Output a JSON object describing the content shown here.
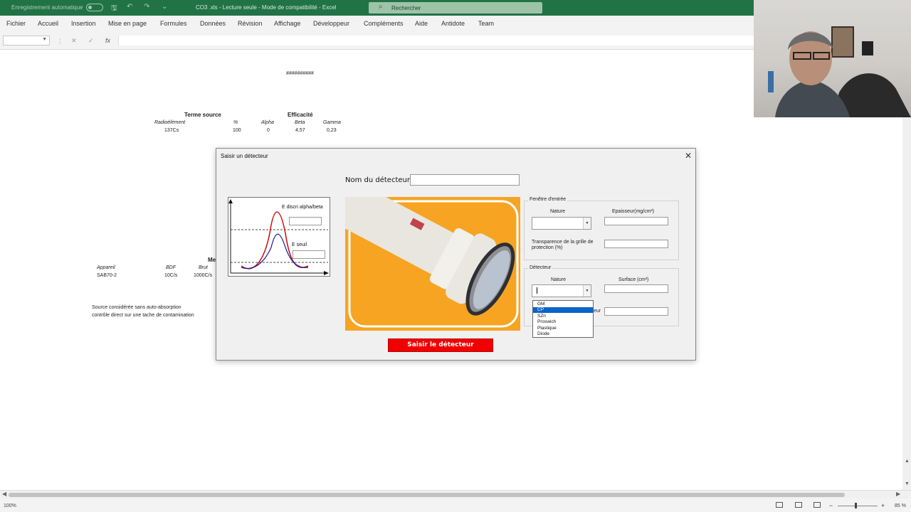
{
  "titlebar": {
    "autosave_label": "Enregistrement automatique",
    "document_title": "CO3 .xls  -  Lecture seule  -  Mode de compatibilité  -  Excel",
    "search_placeholder": "Rechercher"
  },
  "menu": {
    "items": [
      "Fichier",
      "Accueil",
      "Insertion",
      "Mise en page",
      "Formules",
      "Données",
      "Révision",
      "Affichage",
      "Développeur",
      "Compléments",
      "Aide",
      "Antidote",
      "Team"
    ]
  },
  "formula_bar": {
    "fx": "fx",
    "cancel": "✕",
    "enter": "✓"
  },
  "sheet": {
    "hash_cell": "##########",
    "terme_source": "Terme source",
    "efficacite": "Efficacité",
    "headers": [
      "Radioélément",
      "%",
      "Alpha",
      "Beta",
      "Gamma"
    ],
    "row": [
      "137Cs",
      "100",
      "0",
      "4,57",
      "0,23"
    ],
    "me_label": "Me",
    "appareil_headers": [
      "Appareil",
      "BDF",
      "Brut"
    ],
    "appareil_row": [
      "SAB70-2",
      "10C/s",
      "1000C/s"
    ],
    "note1": "Source considérée sans auto-absorption",
    "note2": "contrôle direct sur une tache de contamination"
  },
  "status": {
    "zoom_left": "100%",
    "zoom_right": "85 %",
    "minus": "−",
    "plus": "+"
  },
  "dialog": {
    "title": "Saisir un détecteur",
    "close": "✕",
    "name_label": "Nom du détecteur",
    "name_value": "",
    "graph": {
      "discri_label": "E discri alpha/beta",
      "seuil_label": "E seuil"
    },
    "fenetre": {
      "title": "Fenêtre d'entrée",
      "nature_label": "Nature",
      "epaisseur_label": "Epaisseur(mg/cm²)",
      "transparence_label": "Transparence de la grille de protection (%)"
    },
    "detecteur": {
      "title": "Détecteur",
      "nature_label": "Nature",
      "surface_label": "Surface (cm²)",
      "hidden_label_tail": "eur",
      "options": [
        "GM",
        "CP",
        "SZn",
        "Proswich",
        "Plastique",
        "Diode"
      ],
      "selected_index": 1
    },
    "submit_label": "Saisir le détecteur"
  },
  "colors": {
    "excel_green": "#217346",
    "submit_red": "#f00000",
    "photo_orange": "#f6a422",
    "selection_blue": "#0a64c8"
  },
  "icons": [
    "save-icon",
    "undo-icon",
    "redo-icon",
    "search-icon",
    "close-icon",
    "chevron-down-icon",
    "fx-icon"
  ]
}
